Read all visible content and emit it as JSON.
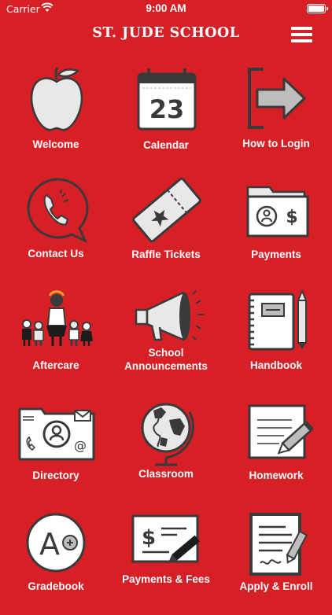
{
  "status_bar": {
    "carrier": "Carrier",
    "time": "9:00 AM"
  },
  "header": {
    "title": "ST. JUDE SCHOOL"
  },
  "calendar_day": "23",
  "tiles": [
    {
      "label": "Welcome",
      "icon": "apple-icon"
    },
    {
      "label": "Calendar",
      "icon": "calendar-icon"
    },
    {
      "label": "How to Login",
      "icon": "login-arrow-icon"
    },
    {
      "label": "Contact Us",
      "icon": "phone-chat-icon"
    },
    {
      "label": "Raffle Tickets",
      "icon": "ticket-icon"
    },
    {
      "label": "Payments",
      "icon": "money-folder-icon"
    },
    {
      "label": "Aftercare",
      "icon": "children-icon"
    },
    {
      "label": "School Announcements",
      "icon": "megaphone-icon"
    },
    {
      "label": "Handbook",
      "icon": "handbook-icon"
    },
    {
      "label": "Directory",
      "icon": "directory-icon"
    },
    {
      "label": "Classroom",
      "icon": "globe-icon"
    },
    {
      "label": "Homework",
      "icon": "homework-icon"
    },
    {
      "label": "Gradebook",
      "icon": "grade-icon"
    },
    {
      "label": "Payments & Fees",
      "icon": "check-icon"
    },
    {
      "label": "Apply & Enroll",
      "icon": "enroll-form-icon"
    }
  ],
  "colors": {
    "background": "#d71f26",
    "icon_fill": "#e8e8e8",
    "icon_stroke": "#3a3a3a"
  }
}
